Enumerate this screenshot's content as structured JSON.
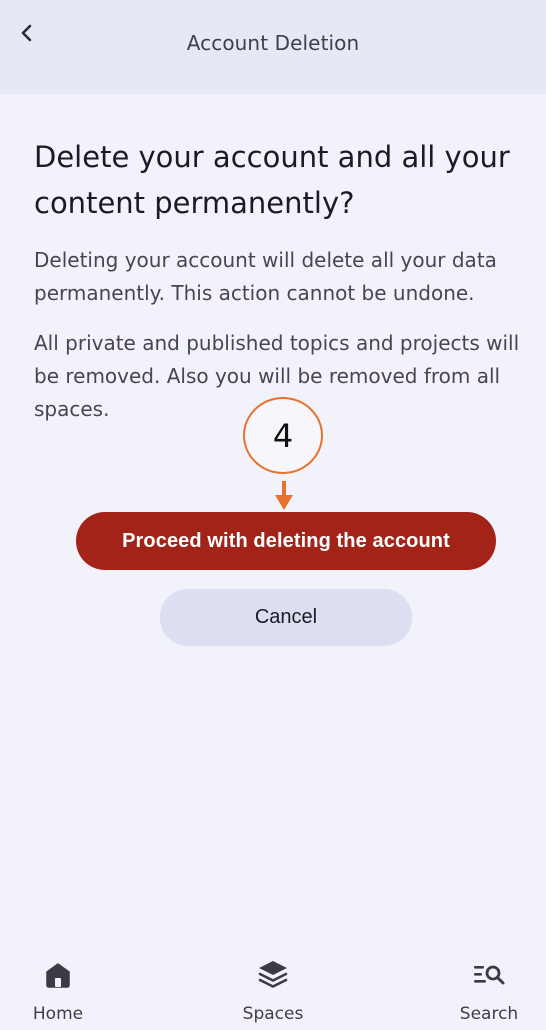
{
  "header": {
    "title": "Account Deletion",
    "back_icon": "chevron-left-icon"
  },
  "content": {
    "heading": "Delete your account and all your content permanently?",
    "paragraph_1": "Deleting your account will delete all your data permanently. This action cannot be undone.",
    "paragraph_2": "All private and published topics and projects will be removed. Also you will be removed from all spaces."
  },
  "annotation": {
    "step_number": "4",
    "accent_color": "#e7722d"
  },
  "actions": {
    "proceed_label": "Proceed with deleting the account",
    "proceed_color": "#a42319",
    "cancel_label": "Cancel",
    "cancel_color": "#dcdff2"
  },
  "bottom_nav": {
    "items": [
      {
        "label": "Home",
        "icon": "home-icon"
      },
      {
        "label": "Spaces",
        "icon": "layers-icon"
      },
      {
        "label": "Search",
        "icon": "search-list-icon"
      }
    ]
  }
}
